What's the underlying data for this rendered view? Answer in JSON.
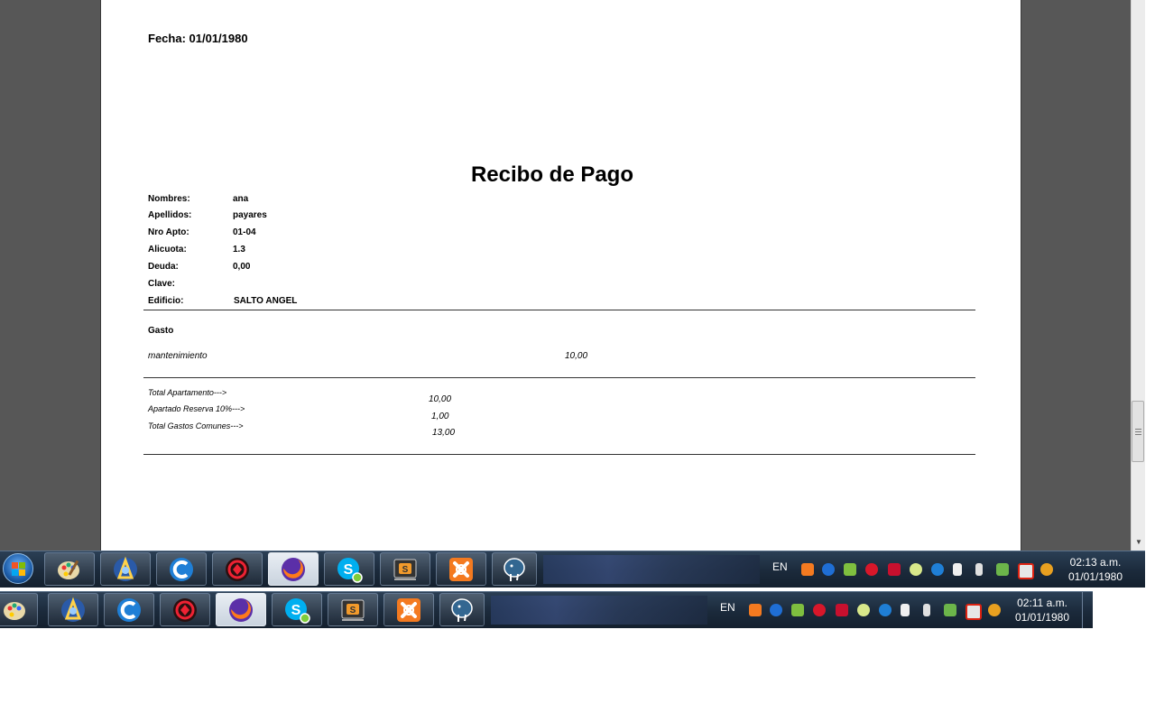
{
  "document": {
    "fecha": "Fecha: 01/01/1980",
    "title": "Recibo de Pago",
    "fields": [
      {
        "label": "Nombres:",
        "value": "ana"
      },
      {
        "label": "Apellidos:",
        "value": "payares"
      },
      {
        "label": "Nro Apto:",
        "value": "01-04"
      },
      {
        "label": "Alicuota:",
        "value": "1.3"
      },
      {
        "label": "Deuda:",
        "value": "0,00"
      },
      {
        "label": "Clave:",
        "value": ""
      },
      {
        "label": "Edificio:",
        "value": "SALTO ANGEL"
      }
    ],
    "gasto_header": "Gasto",
    "gastos": [
      {
        "name": "mantenimiento",
        "amount": "10,00"
      }
    ],
    "totals": [
      {
        "label": "Total Apartamento--->",
        "value": "10,00"
      },
      {
        "label": "Apartado Reserva 10%--->",
        "value": "1,00"
      },
      {
        "label": "Total Gastos Comunes--->",
        "value": "13,00"
      }
    ]
  },
  "taskbar_top": {
    "language": "EN",
    "time": "02:13 a.m.",
    "date": "01/01/1980",
    "apps": [
      "paint-icon",
      "arcgis-icon",
      "ccleaner-icon",
      "avast-icon",
      "firefox-icon",
      "skype-icon",
      "sublime-text-icon",
      "xampp-icon",
      "postgresql-icon"
    ],
    "active_app": "firefox-icon"
  },
  "taskbar_bottom": {
    "language": "EN",
    "time": "02:11 a.m.",
    "date": "01/01/1980",
    "apps": [
      "paint-icon",
      "arcgis-icon",
      "ccleaner-icon",
      "avast-icon",
      "firefox-icon",
      "skype-icon",
      "sublime-text-icon",
      "xampp-icon",
      "postgresql-icon"
    ],
    "active_app": "firefox-icon"
  },
  "colors": {
    "viewer_bg": "#575757",
    "taskbar": "#1b2a3b",
    "xampp": "#f47a20",
    "firefox": "#ff7a1a"
  }
}
